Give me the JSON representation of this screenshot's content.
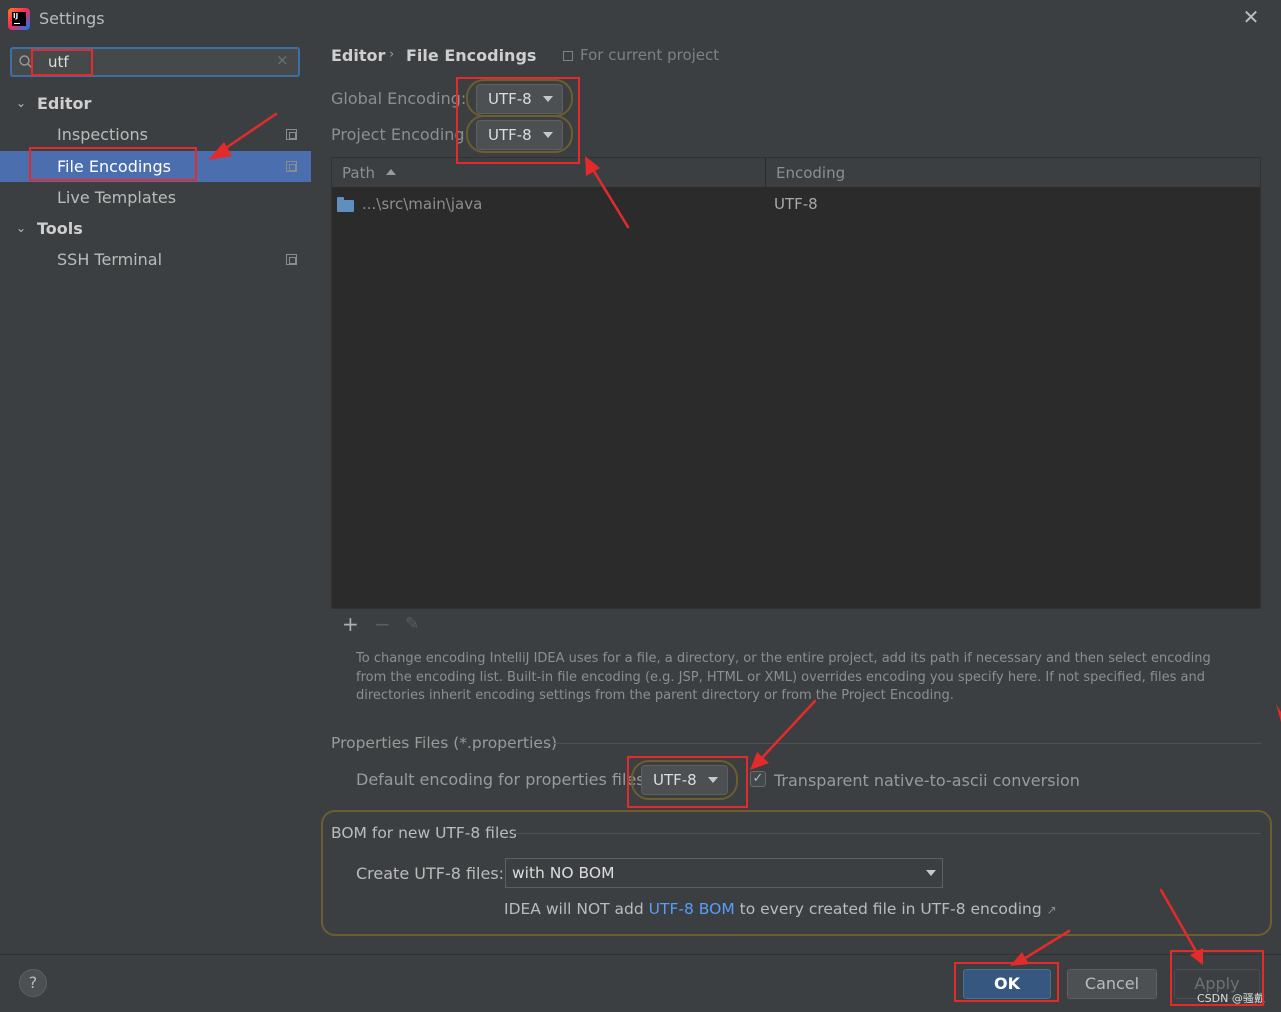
{
  "window": {
    "title": "Settings",
    "close_glyph": "✕"
  },
  "sidebar": {
    "search": {
      "value": "utf",
      "clear_glyph": "×"
    },
    "tree": [
      {
        "label": "Editor",
        "level": 0,
        "expanded": true
      },
      {
        "label": "Inspections",
        "level": 1,
        "project_scope": true
      },
      {
        "label": "File Encodings",
        "level": 1,
        "selected": true,
        "project_scope": true
      },
      {
        "label": "Live Templates",
        "level": 1
      },
      {
        "label": "Tools",
        "level": 0,
        "expanded": true
      },
      {
        "label": "SSH Terminal",
        "level": 1,
        "project_scope": true
      }
    ],
    "chevron_glyph": "⌄"
  },
  "header": {
    "breadcrumb": [
      "Editor",
      "File Encodings"
    ],
    "separator": "›",
    "scope_label": "For current project"
  },
  "encodings": {
    "global_label": "Global Encoding:",
    "global_value": "UTF-8",
    "project_label": "Project Encoding",
    "project_value": "UTF-8"
  },
  "table": {
    "columns": [
      "Path",
      "Encoding"
    ],
    "rows": [
      {
        "path": "...\\src\\main\\java",
        "encoding": "UTF-8"
      }
    ],
    "toolbar": {
      "add": "+",
      "remove": "−",
      "edit": "✎"
    }
  },
  "help_text": "To change encoding IntelliJ IDEA uses for a file, a directory, or the entire project, add its path if necessary and then select encoding from the encoding list. Built-in file encoding (e.g. JSP, HTML or XML) overrides encoding you specify here. If not specified, files and directories inherit encoding settings from the parent directory or from the Project Encoding.",
  "properties": {
    "section_title": "Properties Files (*.properties)",
    "default_label": "Default encoding for properties files:",
    "default_value": "UTF-8",
    "transparent_label": "Transparent native-to-ascii conversion",
    "transparent_checked": true,
    "check_glyph": "✓"
  },
  "bom": {
    "section_title": "BOM for new UTF-8 files",
    "create_label": "Create UTF-8 files:",
    "create_value": "with NO BOM",
    "note_prefix": "IDEA will NOT add ",
    "note_link": "UTF-8 BOM",
    "note_suffix": " to every created file in UTF-8 encoding",
    "note_arrow": "↗"
  },
  "footer": {
    "help_glyph": "?",
    "ok_label": "OK",
    "cancel_label": "Cancel",
    "apply_label": "Apply",
    "watermark": "CSDN @骚戴"
  },
  "colors": {
    "background": "#3c3f41",
    "selection": "#4b6eaf",
    "table_bg": "#2b2b2b",
    "annotation_red": "#e32b2b",
    "link": "#589df6"
  }
}
